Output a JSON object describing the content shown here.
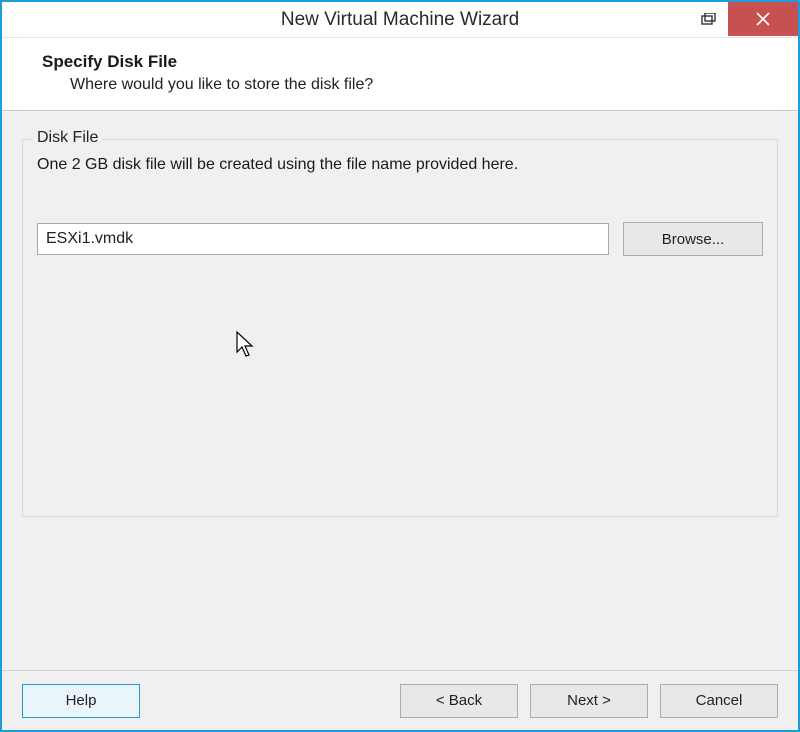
{
  "window": {
    "title": "New Virtual Machine Wizard"
  },
  "header": {
    "title": "Specify Disk File",
    "subtitle": "Where would you like to store the disk file?"
  },
  "fieldset": {
    "legend": "Disk File",
    "description": "One 2 GB disk file will be created using the file name provided here.",
    "file_value": "ESXi1.vmdk",
    "browse_label": "Browse..."
  },
  "footer": {
    "help_label": "Help",
    "back_label": "< Back",
    "next_label": "Next >",
    "cancel_label": "Cancel"
  }
}
